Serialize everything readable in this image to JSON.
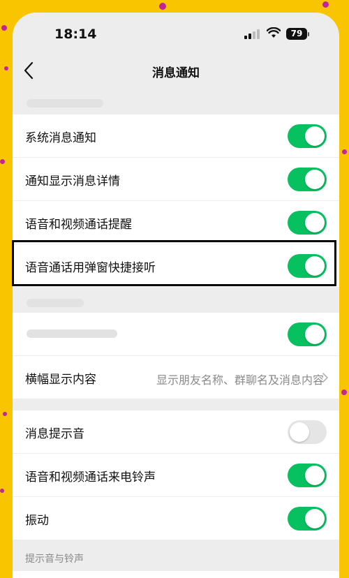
{
  "status_bar": {
    "time": "18:14",
    "battery": "79"
  },
  "nav": {
    "title": "消息通知"
  },
  "notifications": {
    "items": [
      {
        "label": "系统消息通知",
        "on": true
      },
      {
        "label": "通知显示消息详情",
        "on": true
      },
      {
        "label": "语音和视频通话提醒",
        "on": true
      },
      {
        "label": "语音通话用弹窗快捷接听",
        "on": true
      }
    ]
  },
  "banner_section": {
    "banner_toggle_on": true,
    "banner_content_label": "横幅显示内容",
    "banner_content_value": "显示朋友名称、群聊名及消息内容"
  },
  "sound_section": {
    "items": [
      {
        "label": "消息提示音",
        "on": false
      },
      {
        "label": "语音和视频通话来电铃声",
        "on": true
      },
      {
        "label": "振动",
        "on": true
      }
    ]
  },
  "footer_header": "提示音与铃声",
  "colors": {
    "accent": "#07c160",
    "background_frame": "#f9c400",
    "highlight_border": "#000000"
  }
}
